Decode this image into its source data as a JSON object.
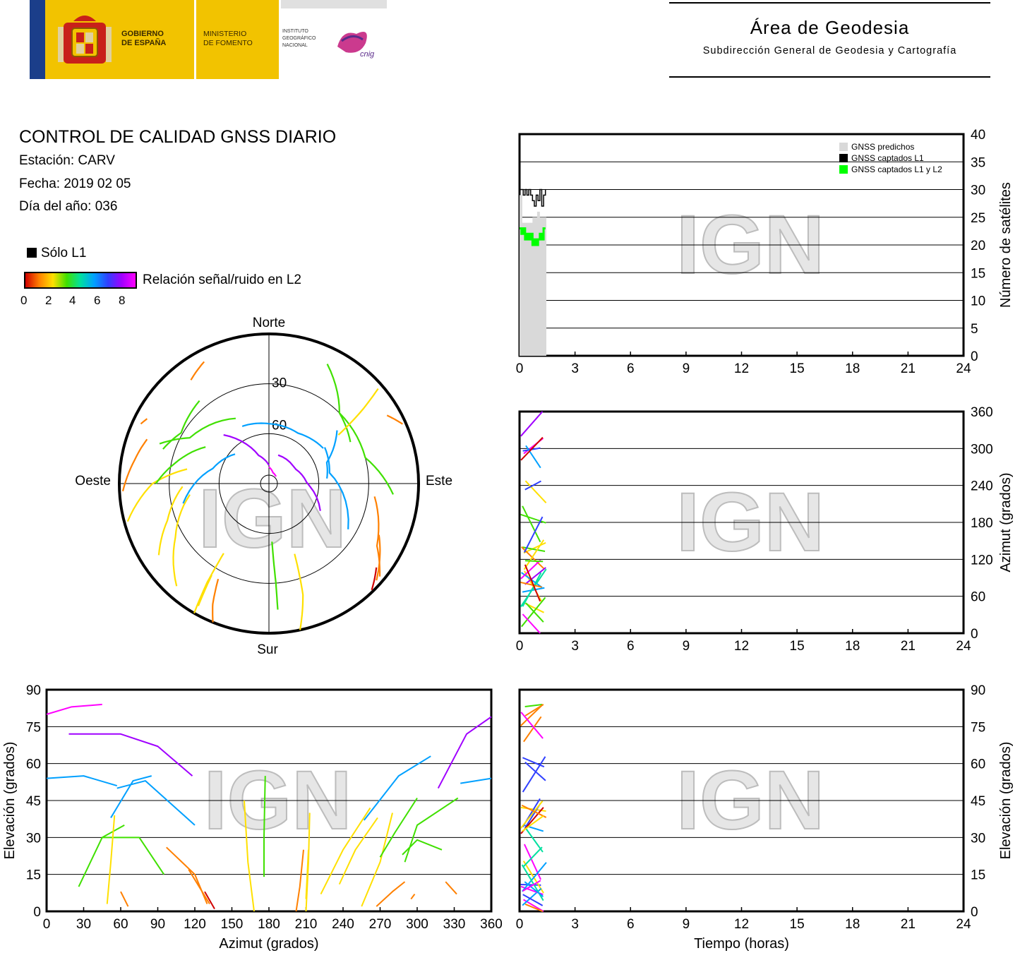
{
  "header": {
    "gov_text_1": "GOBIERNO",
    "gov_text_2": "DE ESPAÑA",
    "ministry_1": "MINISTERIO",
    "ministry_2": "DE FOMENTO",
    "ign_1": "INSTITUTO",
    "ign_2": "GEOGRÁFICO",
    "ign_3": "NACIONAL",
    "ign_logo_text": "cnig",
    "area_title": "Área de Geodesia",
    "area_subtitle": "Subdirección General de Geodesia y Cartografía"
  },
  "info": {
    "title": "CONTROL DE CALIDAD GNSS DIARIO",
    "station": "Estación: CARV",
    "date": "Fecha: 2019 02 05",
    "doy": "Día del año: 036",
    "legend_l1": "Sólo L1",
    "snr_label": "Relación señal/ruido en L2",
    "snr_ticks": [
      "0",
      "2",
      "4",
      "6",
      "8"
    ]
  },
  "watermark": "IGN",
  "colors": {
    "predicted": "#d9d9d9",
    "l1": "#000000",
    "l1l2": "#00ff00",
    "snr_scale": [
      "#d00000",
      "#ff8000",
      "#ffe000",
      "#40e000",
      "#00e0a0",
      "#00a0ff",
      "#3040ff",
      "#a000ff",
      "#ff00ff"
    ]
  },
  "chart_data": [
    {
      "id": "satellites",
      "type": "line",
      "ylabel": "Número de satélites",
      "xlim": [
        0,
        24
      ],
      "ylim": [
        0,
        40
      ],
      "x_ticks": [
        "0",
        "3",
        "6",
        "9",
        "12",
        "15",
        "18",
        "21",
        "24"
      ],
      "y_ticks": [
        "0",
        "5",
        "10",
        "15",
        "20",
        "25",
        "30",
        "35",
        "40"
      ],
      "legend": [
        "GNSS predichos",
        "GNSS captados L1",
        "GNSS captados L1 y L2"
      ],
      "series": [
        {
          "name": "GNSS predichos",
          "x": [
            0.0,
            0.15,
            0.15,
            0.7,
            0.7,
            0.95,
            0.95,
            1.1,
            1.1,
            1.45
          ],
          "y": [
            29,
            29,
            24,
            24,
            25,
            25,
            26,
            26,
            25,
            25
          ]
        },
        {
          "name": "GNSS captados L1",
          "x": [
            0.0,
            0.1,
            0.2,
            0.3,
            0.4,
            0.5,
            0.6,
            0.7,
            0.8,
            0.9,
            1.0,
            1.1,
            1.2,
            1.3,
            1.4
          ],
          "y": [
            30,
            30,
            29,
            30,
            29,
            30,
            29,
            28,
            27,
            29,
            28,
            30,
            27,
            29,
            30
          ]
        },
        {
          "name": "GNSS captados L1 y L2",
          "x": [
            0.0,
            0.1,
            0.2,
            0.3,
            0.4,
            0.5,
            0.6,
            0.7,
            0.8,
            0.9,
            1.0,
            1.1,
            1.2,
            1.3,
            1.4
          ],
          "y": [
            23,
            22,
            23,
            21,
            22,
            21,
            22,
            20,
            21,
            20,
            21,
            22,
            21,
            23,
            23
          ]
        }
      ]
    },
    {
      "id": "azimuth",
      "type": "scatter",
      "ylabel": "Azimut (grados)",
      "xlim": [
        0,
        24
      ],
      "ylim": [
        0,
        360
      ],
      "x_ticks": [
        "0",
        "3",
        "6",
        "9",
        "12",
        "15",
        "18",
        "21",
        "24"
      ],
      "y_ticks": [
        "0",
        "60",
        "120",
        "180",
        "240",
        "300",
        "360"
      ]
    },
    {
      "id": "skyplot",
      "type": "scatter",
      "labels": {
        "north": "Norte",
        "south": "Sur",
        "east": "Este",
        "west": "Oeste"
      },
      "ring_labels": [
        "30",
        "60"
      ]
    },
    {
      "id": "elev_vs_az",
      "type": "scatter",
      "xlabel": "Azimut (grados)",
      "ylabel": "Elevación (grados)",
      "xlim": [
        0,
        360
      ],
      "ylim": [
        0,
        90
      ],
      "x_ticks": [
        "0",
        "30",
        "60",
        "90",
        "120",
        "150",
        "180",
        "210",
        "240",
        "270",
        "300",
        "330",
        "360"
      ],
      "y_ticks": [
        "0",
        "15",
        "30",
        "45",
        "60",
        "75",
        "90"
      ],
      "tracks": [
        {
          "az": [
            0,
            20,
            45
          ],
          "el": [
            80,
            83,
            84
          ]
        },
        {
          "az": [
            18,
            60,
            90,
            118
          ],
          "el": [
            72,
            72,
            67,
            55
          ]
        },
        {
          "az": [
            0,
            30,
            57
          ],
          "el": [
            54,
            55,
            51
          ]
        },
        {
          "az": [
            57,
            80,
            120
          ],
          "el": [
            50,
            53,
            35
          ]
        },
        {
          "az": [
            52,
            70,
            85
          ],
          "el": [
            38,
            53,
            55
          ]
        },
        {
          "az": [
            26,
            45,
            63
          ],
          "el": [
            10,
            30,
            35
          ]
        },
        {
          "az": [
            45,
            75,
            95
          ],
          "el": [
            30,
            30,
            15
          ]
        },
        {
          "az": [
            49,
            52,
            55
          ],
          "el": [
            3,
            20,
            39
          ]
        },
        {
          "az": [
            60,
            66
          ],
          "el": [
            8,
            2
          ]
        },
        {
          "az": [
            97,
            120,
            130
          ],
          "el": [
            26,
            15,
            3
          ]
        },
        {
          "az": [
            115,
            132
          ],
          "el": [
            17,
            3
          ]
        },
        {
          "az": [
            128,
            136
          ],
          "el": [
            8,
            1
          ]
        },
        {
          "az": [
            160,
            163,
            168
          ],
          "el": [
            45,
            20,
            0
          ]
        },
        {
          "az": [
            177,
            176,
            176
          ],
          "el": [
            55,
            30,
            14
          ]
        },
        {
          "az": [
            202,
            205,
            208
          ],
          "el": [
            0,
            10,
            25
          ]
        },
        {
          "az": [
            210,
            212
          ],
          "el": [
            5,
            25
          ]
        },
        {
          "az": [
            213,
            212,
            210
          ],
          "el": [
            40,
            20,
            0
          ]
        },
        {
          "az": [
            222,
            240,
            262
          ],
          "el": [
            7,
            25,
            42
          ]
        },
        {
          "az": [
            237,
            250,
            268
          ],
          "el": [
            11,
            25,
            38
          ]
        },
        {
          "az": [
            257,
            285,
            311
          ],
          "el": [
            37,
            55,
            63
          ]
        },
        {
          "az": [
            255,
            270,
            280
          ],
          "el": [
            2,
            20,
            40
          ]
        },
        {
          "az": [
            270,
            282,
            300
          ],
          "el": [
            22,
            32,
            46
          ]
        },
        {
          "az": [
            288,
            300,
            320
          ],
          "el": [
            23,
            29,
            25
          ]
        },
        {
          "az": [
            267,
            280,
            290
          ],
          "el": [
            2,
            8,
            12
          ]
        },
        {
          "az": [
            290,
            300,
            333
          ],
          "el": [
            20,
            35,
            46
          ]
        },
        {
          "az": [
            295,
            298
          ],
          "el": [
            5,
            7
          ]
        },
        {
          "az": [
            323,
            332
          ],
          "el": [
            12,
            7
          ]
        },
        {
          "az": [
            317,
            340,
            360
          ],
          "el": [
            50,
            72,
            79
          ]
        },
        {
          "az": [
            335,
            360
          ],
          "el": [
            52,
            54
          ]
        }
      ]
    },
    {
      "id": "elev_vs_time",
      "type": "scatter",
      "xlabel": "Tiempo (horas)",
      "ylabel": "Elevación (grados)",
      "xlim": [
        0,
        24
      ],
      "ylim": [
        0,
        90
      ],
      "x_ticks": [
        "0",
        "3",
        "6",
        "9",
        "12",
        "15",
        "18",
        "21",
        "24"
      ],
      "y_ticks": [
        "0",
        "15",
        "30",
        "45",
        "60",
        "75",
        "90"
      ]
    }
  ]
}
